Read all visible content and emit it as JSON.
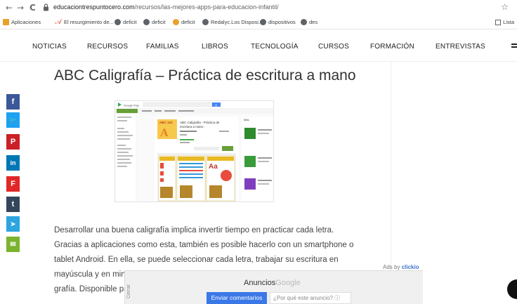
{
  "browser": {
    "back": "←",
    "forward": "→",
    "reload": "C",
    "url_host": "educaciontrespuntocero.com",
    "url_path": "/recursos/las-mejores-apps-para-educacion-infantil/",
    "star": "☆"
  },
  "bookmarks": {
    "items": [
      {
        "label": "Aplicaciones",
        "icon": "apps-grid-icon"
      },
      {
        "label": "El resurgimiento de...",
        "icon": "feather-icon"
      },
      {
        "label": "deficit",
        "icon": "globe-icon"
      },
      {
        "label": "deficit",
        "icon": "globe-icon"
      },
      {
        "label": "deficit",
        "icon": "sun-icon"
      },
      {
        "label": "Redalyc.Los Disposi...",
        "icon": "globe-icon"
      },
      {
        "label": "dispositivos",
        "icon": "globe-icon"
      },
      {
        "label": "des",
        "icon": "globe-icon"
      }
    ],
    "right_label": "Lista"
  },
  "nav": {
    "items": [
      "NOTICIAS",
      "RECURSOS",
      "FAMILIAS",
      "LIBROS",
      "TECNOLOGÍA",
      "CURSOS",
      "FORMACIÓN",
      "ENTREVISTAS"
    ]
  },
  "article": {
    "title": "ABC Caligrafía – Práctica de escritura a mano",
    "screenshot": {
      "store_name": "Google Play",
      "search_btn": "Q",
      "app_title_line1": "ABC Caligrafía - Práctica de",
      "app_title_line2": "escritura a mano",
      "app_icon_text": "ABC 123",
      "more_label": "Más"
    },
    "paragraph_lines": [
      "Desarrollar una buena caligrafía implica invertir tiempo en practicar cada letra.",
      "Gracias a aplicaciones como esta, también es posible hacerlo con un smartphone o",
      "tablet Android. En ella, se puede seleccionar cada letra, trabajar su escritura en",
      "mayúscula y en minú",
      "grafía. Disponible pa"
    ]
  },
  "social": [
    {
      "name": "facebook",
      "glyph": "f",
      "color": "#3b5998"
    },
    {
      "name": "twitter",
      "glyph": "🐦",
      "color": "#1da1f2"
    },
    {
      "name": "pinterest",
      "glyph": "P",
      "color": "#cb2027"
    },
    {
      "name": "linkedin",
      "glyph": "in",
      "color": "#0077b5"
    },
    {
      "name": "flipboard",
      "glyph": "F",
      "color": "#e12828"
    },
    {
      "name": "tumblr",
      "glyph": "t",
      "color": "#35465c"
    },
    {
      "name": "telegram",
      "glyph": "➤",
      "color": "#2ca5e0"
    },
    {
      "name": "email",
      "glyph": "✉",
      "color": "#7bb32e"
    }
  ],
  "ads": {
    "ads_by": "Ads by",
    "ads_brand": "clickio",
    "close_label": "Cerrar",
    "anuncios": "Anuncios",
    "google": "Google",
    "send_feedback": "Enviar comentarios",
    "why_ad": "¿Por qué este anuncio? ⓘ"
  }
}
